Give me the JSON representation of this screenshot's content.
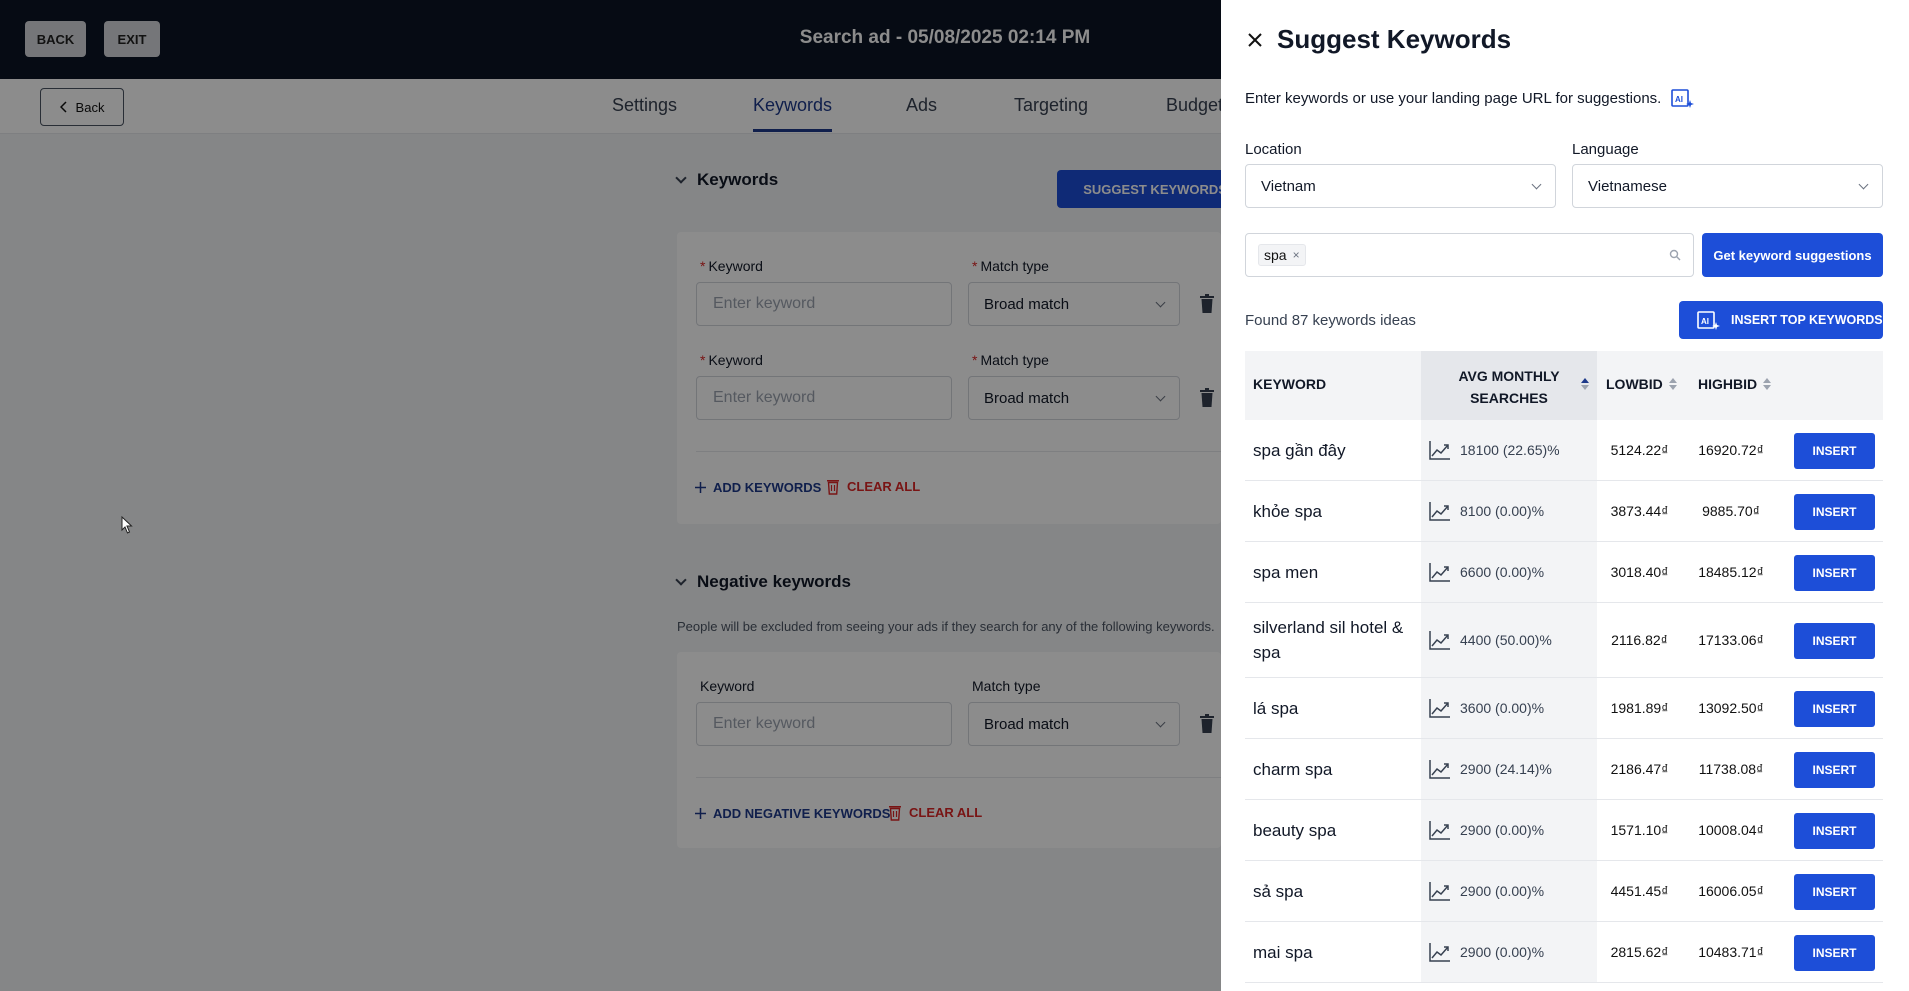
{
  "topbar": {
    "back_label": "BACK",
    "exit_label": "EXIT",
    "title": "Search ad - 05/08/2025 02:14 PM"
  },
  "subnav": {
    "back_label": "Back",
    "tabs": [
      {
        "label": "Settings"
      },
      {
        "label": "Keywords",
        "active": true
      },
      {
        "label": "Ads"
      },
      {
        "label": "Targeting"
      },
      {
        "label": "Budget"
      }
    ]
  },
  "keywords_section": {
    "title": "Keywords",
    "suggest_label": "SUGGEST KEYWORDS",
    "rows": [
      {
        "keyword_label": "Keyword",
        "keyword_placeholder": "Enter keyword",
        "match_label": "Match type",
        "match_value": "Broad match"
      },
      {
        "keyword_label": "Keyword",
        "keyword_placeholder": "Enter keyword",
        "match_label": "Match type",
        "match_value": "Broad match"
      }
    ],
    "add_label": "ADD KEYWORDS",
    "clear_label": "CLEAR ALL"
  },
  "negative_section": {
    "title": "Negative keywords",
    "description": "People will be excluded from seeing your ads if they search for any of the following keywords.",
    "keyword_label": "Keyword",
    "keyword_placeholder": "Enter keyword",
    "match_label": "Match type",
    "match_value": "Broad match",
    "add_label": "ADD NEGATIVE KEYWORDS",
    "clear_label": "CLEAR ALL"
  },
  "drawer": {
    "title": "Suggest Keywords",
    "hint": "Enter keywords or use your landing page URL for suggestions.",
    "location_label": "Location",
    "location_value": "Vietnam",
    "language_label": "Language",
    "language_value": "Vietnamese",
    "tag": "spa",
    "get_label": "Get keyword suggestions",
    "found_text": "Found 87 keywords ideas",
    "insert_top_label": "INSERT TOP KEYWORDS",
    "columns": {
      "keyword": "KEYWORD",
      "avg_line1": "AVG MONTHLY",
      "avg_line2": "SEARCHES",
      "low": "LOWBID",
      "high": "HIGHBID"
    },
    "insert_label": "INSERT",
    "results": [
      {
        "keyword": "spa gần đây",
        "avg": "18100 (22.65)%",
        "low": "5124.22₫",
        "high": "16920.72₫"
      },
      {
        "keyword": "khỏe spa",
        "avg": "8100 (0.00)%",
        "low": "3873.44₫",
        "high": "9885.70₫"
      },
      {
        "keyword": "spa men",
        "avg": "6600 (0.00)%",
        "low": "3018.40₫",
        "high": "18485.12₫"
      },
      {
        "keyword": "silverland sil hotel & spa",
        "avg": "4400 (50.00)%",
        "low": "2116.82₫",
        "high": "17133.06₫"
      },
      {
        "keyword": "lá spa",
        "avg": "3600 (0.00)%",
        "low": "1981.89₫",
        "high": "13092.50₫"
      },
      {
        "keyword": "charm spa",
        "avg": "2900 (24.14)%",
        "low": "2186.47₫",
        "high": "11738.08₫"
      },
      {
        "keyword": "beauty spa",
        "avg": "2900 (0.00)%",
        "low": "1571.10₫",
        "high": "10008.04₫"
      },
      {
        "keyword": "sả spa",
        "avg": "2900 (0.00)%",
        "low": "4451.45₫",
        "high": "16006.05₫"
      },
      {
        "keyword": "mai spa",
        "avg": "2900 (0.00)%",
        "low": "2815.62₫",
        "high": "10483.71₫"
      }
    ]
  },
  "colors": {
    "primary": "#1d4ed8",
    "navy": "#0b1426",
    "accent_text": "#1e3a8a",
    "danger": "#dc2626"
  }
}
